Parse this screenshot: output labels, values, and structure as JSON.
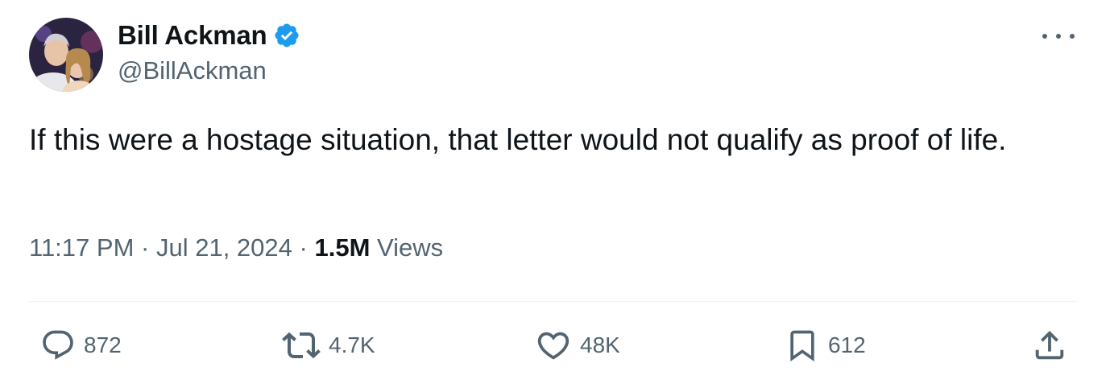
{
  "tweet": {
    "author": {
      "display_name": "Bill Ackman",
      "handle": "@BillAckman",
      "verified": true
    },
    "text": "If this were a hostage situation, that letter would not qualify as proof of life.",
    "meta": {
      "time": "11:17 PM",
      "separator": "·",
      "date": "Jul 21, 2024",
      "views_count": "1.5M",
      "views_label": "Views"
    },
    "actions": {
      "replies": "872",
      "reposts": "4.7K",
      "likes": "48K",
      "bookmarks": "612"
    },
    "colors": {
      "text_primary": "#0f1419",
      "text_secondary": "#536471",
      "verified_blue": "#1d9bf0",
      "divider": "#eff3f4"
    },
    "icons": [
      "verified-badge-icon",
      "more-options-icon",
      "reply-icon",
      "repost-icon",
      "like-icon",
      "bookmark-icon",
      "share-icon"
    ]
  }
}
